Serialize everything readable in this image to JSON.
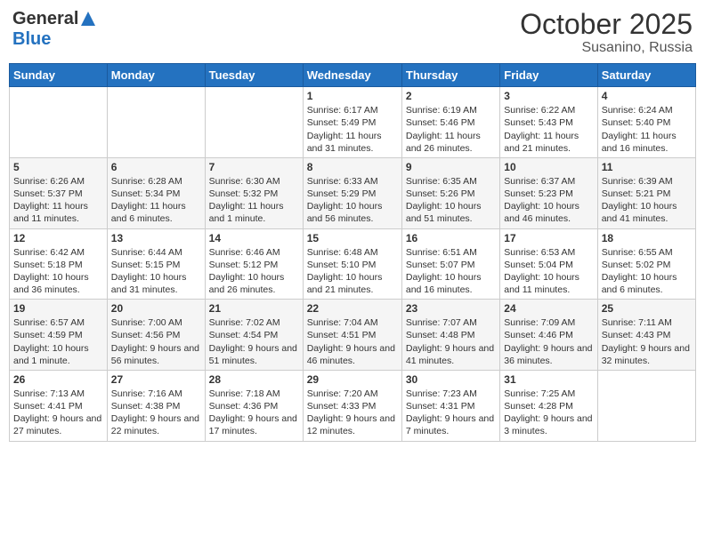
{
  "header": {
    "logo_general": "General",
    "logo_blue": "Blue",
    "month": "October 2025",
    "location": "Susanino, Russia"
  },
  "days_of_week": [
    "Sunday",
    "Monday",
    "Tuesday",
    "Wednesday",
    "Thursday",
    "Friday",
    "Saturday"
  ],
  "weeks": [
    [
      {
        "day": "",
        "content": ""
      },
      {
        "day": "",
        "content": ""
      },
      {
        "day": "",
        "content": ""
      },
      {
        "day": "1",
        "content": "Sunrise: 6:17 AM\nSunset: 5:49 PM\nDaylight: 11 hours and 31 minutes."
      },
      {
        "day": "2",
        "content": "Sunrise: 6:19 AM\nSunset: 5:46 PM\nDaylight: 11 hours and 26 minutes."
      },
      {
        "day": "3",
        "content": "Sunrise: 6:22 AM\nSunset: 5:43 PM\nDaylight: 11 hours and 21 minutes."
      },
      {
        "day": "4",
        "content": "Sunrise: 6:24 AM\nSunset: 5:40 PM\nDaylight: 11 hours and 16 minutes."
      }
    ],
    [
      {
        "day": "5",
        "content": "Sunrise: 6:26 AM\nSunset: 5:37 PM\nDaylight: 11 hours and 11 minutes."
      },
      {
        "day": "6",
        "content": "Sunrise: 6:28 AM\nSunset: 5:34 PM\nDaylight: 11 hours and 6 minutes."
      },
      {
        "day": "7",
        "content": "Sunrise: 6:30 AM\nSunset: 5:32 PM\nDaylight: 11 hours and 1 minute."
      },
      {
        "day": "8",
        "content": "Sunrise: 6:33 AM\nSunset: 5:29 PM\nDaylight: 10 hours and 56 minutes."
      },
      {
        "day": "9",
        "content": "Sunrise: 6:35 AM\nSunset: 5:26 PM\nDaylight: 10 hours and 51 minutes."
      },
      {
        "day": "10",
        "content": "Sunrise: 6:37 AM\nSunset: 5:23 PM\nDaylight: 10 hours and 46 minutes."
      },
      {
        "day": "11",
        "content": "Sunrise: 6:39 AM\nSunset: 5:21 PM\nDaylight: 10 hours and 41 minutes."
      }
    ],
    [
      {
        "day": "12",
        "content": "Sunrise: 6:42 AM\nSunset: 5:18 PM\nDaylight: 10 hours and 36 minutes."
      },
      {
        "day": "13",
        "content": "Sunrise: 6:44 AM\nSunset: 5:15 PM\nDaylight: 10 hours and 31 minutes."
      },
      {
        "day": "14",
        "content": "Sunrise: 6:46 AM\nSunset: 5:12 PM\nDaylight: 10 hours and 26 minutes."
      },
      {
        "day": "15",
        "content": "Sunrise: 6:48 AM\nSunset: 5:10 PM\nDaylight: 10 hours and 21 minutes."
      },
      {
        "day": "16",
        "content": "Sunrise: 6:51 AM\nSunset: 5:07 PM\nDaylight: 10 hours and 16 minutes."
      },
      {
        "day": "17",
        "content": "Sunrise: 6:53 AM\nSunset: 5:04 PM\nDaylight: 10 hours and 11 minutes."
      },
      {
        "day": "18",
        "content": "Sunrise: 6:55 AM\nSunset: 5:02 PM\nDaylight: 10 hours and 6 minutes."
      }
    ],
    [
      {
        "day": "19",
        "content": "Sunrise: 6:57 AM\nSunset: 4:59 PM\nDaylight: 10 hours and 1 minute."
      },
      {
        "day": "20",
        "content": "Sunrise: 7:00 AM\nSunset: 4:56 PM\nDaylight: 9 hours and 56 minutes."
      },
      {
        "day": "21",
        "content": "Sunrise: 7:02 AM\nSunset: 4:54 PM\nDaylight: 9 hours and 51 minutes."
      },
      {
        "day": "22",
        "content": "Sunrise: 7:04 AM\nSunset: 4:51 PM\nDaylight: 9 hours and 46 minutes."
      },
      {
        "day": "23",
        "content": "Sunrise: 7:07 AM\nSunset: 4:48 PM\nDaylight: 9 hours and 41 minutes."
      },
      {
        "day": "24",
        "content": "Sunrise: 7:09 AM\nSunset: 4:46 PM\nDaylight: 9 hours and 36 minutes."
      },
      {
        "day": "25",
        "content": "Sunrise: 7:11 AM\nSunset: 4:43 PM\nDaylight: 9 hours and 32 minutes."
      }
    ],
    [
      {
        "day": "26",
        "content": "Sunrise: 7:13 AM\nSunset: 4:41 PM\nDaylight: 9 hours and 27 minutes."
      },
      {
        "day": "27",
        "content": "Sunrise: 7:16 AM\nSunset: 4:38 PM\nDaylight: 9 hours and 22 minutes."
      },
      {
        "day": "28",
        "content": "Sunrise: 7:18 AM\nSunset: 4:36 PM\nDaylight: 9 hours and 17 minutes."
      },
      {
        "day": "29",
        "content": "Sunrise: 7:20 AM\nSunset: 4:33 PM\nDaylight: 9 hours and 12 minutes."
      },
      {
        "day": "30",
        "content": "Sunrise: 7:23 AM\nSunset: 4:31 PM\nDaylight: 9 hours and 7 minutes."
      },
      {
        "day": "31",
        "content": "Sunrise: 7:25 AM\nSunset: 4:28 PM\nDaylight: 9 hours and 3 minutes."
      },
      {
        "day": "",
        "content": ""
      }
    ]
  ]
}
